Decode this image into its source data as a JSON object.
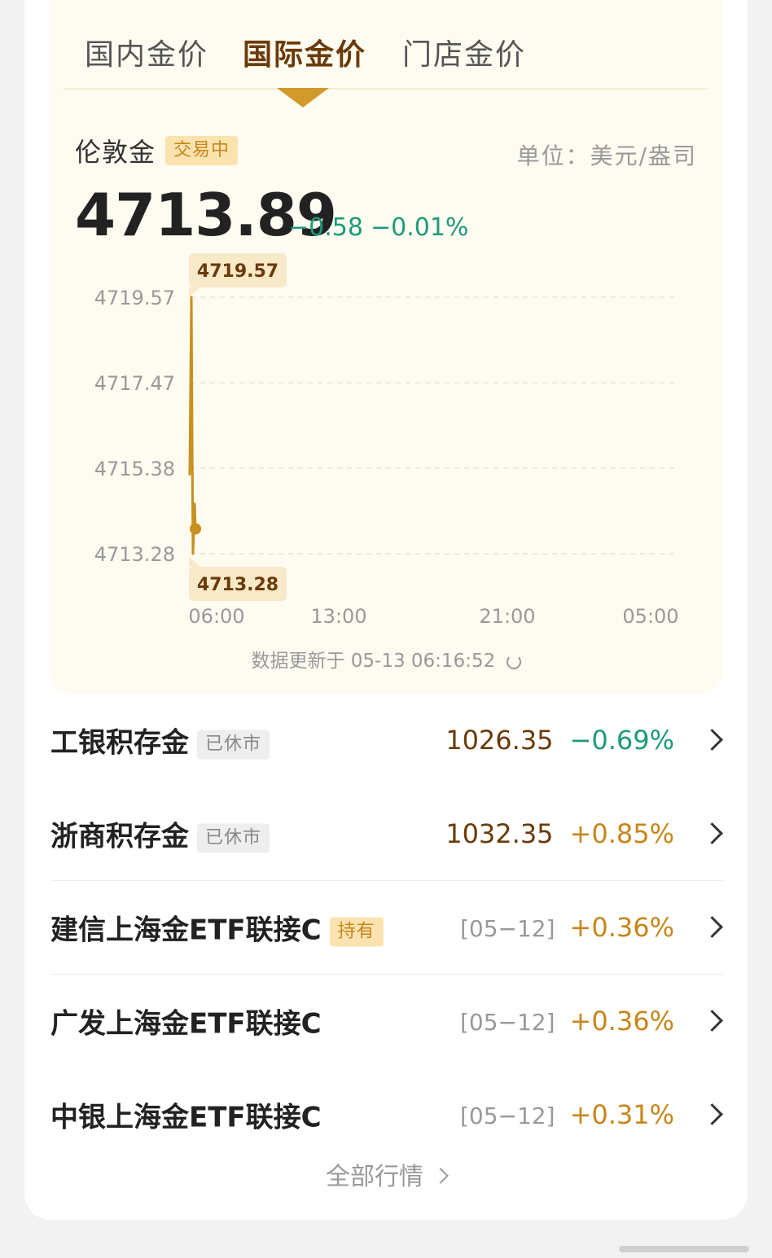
{
  "tabs": [
    {
      "label": "国内金价",
      "active": false
    },
    {
      "label": "国际金价",
      "active": true
    },
    {
      "label": "门店金价",
      "active": false
    }
  ],
  "market": {
    "name": "伦敦金",
    "status": "交易中",
    "unit": "单位：美元/盎司",
    "price": "4713.89",
    "change": "−0.58",
    "change_pct": "−0.01%"
  },
  "chart_data": {
    "type": "line",
    "y_ticks": [
      "4719.57",
      "4717.47",
      "4715.38",
      "4713.28"
    ],
    "x_ticks": [
      "06:00",
      "13:00",
      "21:00",
      "05:00"
    ],
    "ylim": [
      4713.28,
      4719.57
    ],
    "high_label": "4719.57",
    "low_label": "4713.28",
    "series": [
      {
        "values": [
          4715.2,
          4719.57,
          4716.0,
          4713.28,
          4714.5,
          4713.89
        ]
      }
    ],
    "current": 4713.89,
    "grid": true,
    "colors": {
      "line": "#c8901c",
      "grid": "#ece3cf",
      "tick": "#999999"
    }
  },
  "update_text": "数据更新于 05-13 06:16:52",
  "rows": [
    {
      "name": "工银积存金",
      "tag": "已休市",
      "tag_type": "closed",
      "value": "1026.35",
      "date": "",
      "pct": "−0.69%",
      "dir": "down"
    },
    {
      "name": "浙商积存金",
      "tag": "已休市",
      "tag_type": "closed",
      "value": "1032.35",
      "date": "",
      "pct": "+0.85%",
      "dir": "up"
    },
    {
      "name": "建信上海金ETF联接C",
      "tag": "持有",
      "tag_type": "hold",
      "value": "",
      "date": "[05−12]",
      "pct": "+0.36%",
      "dir": "up"
    },
    {
      "name": "广发上海金ETF联接C",
      "tag": "",
      "tag_type": "",
      "value": "",
      "date": "[05−12]",
      "pct": "+0.36%",
      "dir": "up"
    },
    {
      "name": "中银上海金ETF联接C",
      "tag": "",
      "tag_type": "",
      "value": "",
      "date": "[05−12]",
      "pct": "+0.31%",
      "dir": "up"
    }
  ],
  "all_link": "全部行情"
}
